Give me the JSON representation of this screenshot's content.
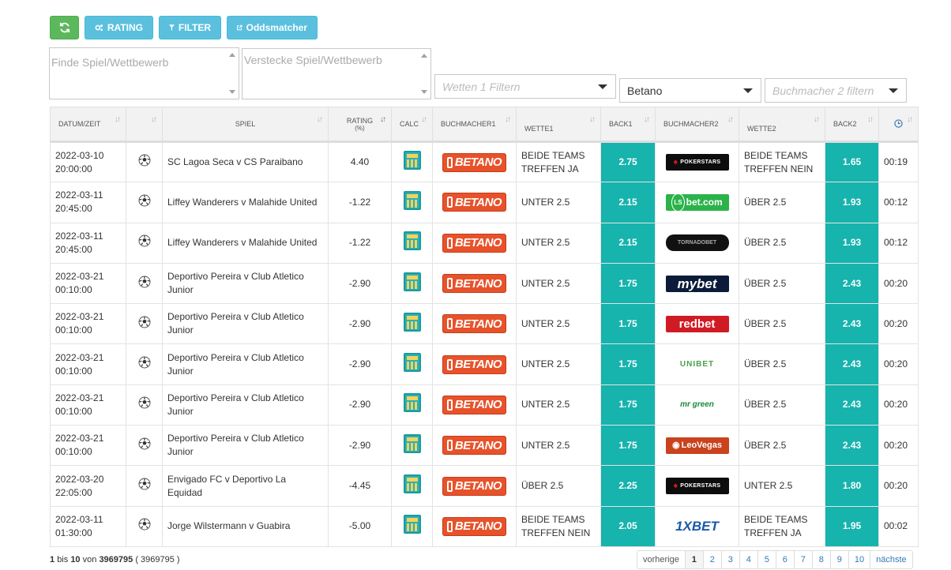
{
  "toolbar": {
    "refresh_icon": "refresh-icon",
    "rating_label": "RATING",
    "filter_label": "FILTER",
    "oddsmatcher_label": "Oddsmatcher",
    "colors": {
      "green": "#5cb85c",
      "blue": "#5bc0de"
    }
  },
  "filters": {
    "find_placeholder": "Finde Spiel/Wettbewerb",
    "hide_placeholder": "Verstecke Spiel/Wettbewerb",
    "bet1_placeholder": "Wetten 1 Filtern",
    "bookmaker1_value": "Betano",
    "bookmaker2_placeholder": "Buchmacher 2 filtern"
  },
  "table": {
    "headers": {
      "date": "DATUM/ZEIT",
      "game": "SPIEL",
      "rating": "RATING",
      "rating_sub": "(%)",
      "calc": "CALC",
      "bookmaker1": "BUCHMACHER1",
      "bet1": "WETTE1",
      "back1": "BACK1",
      "bookmaker2": "BUCHMACHER2",
      "bet2": "WETTE2",
      "back2": "BACK2"
    },
    "accent_color": "#17b3ad",
    "rows": [
      {
        "date": "2022-03-10",
        "time": "20:00:00",
        "game": "SC Lagoa Seca v CS Paraibano",
        "rating": "4.40",
        "bookmaker1": "BETANO",
        "bet1": "BEIDE TEAMS TREFFEN JA",
        "back1": "2.75",
        "bookmaker2": "POKERSTARS",
        "bet2": "BEIDE TEAMS TREFFEN NEIN",
        "back2": "1.65",
        "age": "00:19"
      },
      {
        "date": "2022-03-11",
        "time": "20:45:00",
        "game": "Liffey Wanderers v Malahide United",
        "rating": "-1.22",
        "bookmaker1": "BETANO",
        "bet1": "UNTER 2.5",
        "back1": "2.15",
        "bookmaker2": "bet.com",
        "bet2": "ÜBER 2.5",
        "back2": "1.93",
        "age": "00:12"
      },
      {
        "date": "2022-03-11",
        "time": "20:45:00",
        "game": "Liffey Wanderers v Malahide United",
        "rating": "-1.22",
        "bookmaker1": "BETANO",
        "bet1": "UNTER 2.5",
        "back1": "2.15",
        "bookmaker2": "TORNADOBET",
        "bet2": "ÜBER 2.5",
        "back2": "1.93",
        "age": "00:12"
      },
      {
        "date": "2022-03-21",
        "time": "00:10:00",
        "game": "Deportivo Pereira v Club Atletico Junior",
        "rating": "-2.90",
        "bookmaker1": "BETANO",
        "bet1": "UNTER 2.5",
        "back1": "1.75",
        "bookmaker2": "mybet",
        "bet2": "ÜBER 2.5",
        "back2": "2.43",
        "age": "00:20"
      },
      {
        "date": "2022-03-21",
        "time": "00:10:00",
        "game": "Deportivo Pereira v Club Atletico Junior",
        "rating": "-2.90",
        "bookmaker1": "BETANO",
        "bet1": "UNTER 2.5",
        "back1": "1.75",
        "bookmaker2": "redbet",
        "bet2": "ÜBER 2.5",
        "back2": "2.43",
        "age": "00:20"
      },
      {
        "date": "2022-03-21",
        "time": "00:10:00",
        "game": "Deportivo Pereira v Club Atletico Junior",
        "rating": "-2.90",
        "bookmaker1": "BETANO",
        "bet1": "UNTER 2.5",
        "back1": "1.75",
        "bookmaker2": "UNIBET",
        "bet2": "ÜBER 2.5",
        "back2": "2.43",
        "age": "00:20"
      },
      {
        "date": "2022-03-21",
        "time": "00:10:00",
        "game": "Deportivo Pereira v Club Atletico Junior",
        "rating": "-2.90",
        "bookmaker1": "BETANO",
        "bet1": "UNTER 2.5",
        "back1": "1.75",
        "bookmaker2": "mr green",
        "bet2": "ÜBER 2.5",
        "back2": "2.43",
        "age": "00:20"
      },
      {
        "date": "2022-03-21",
        "time": "00:10:00",
        "game": "Deportivo Pereira v Club Atletico Junior",
        "rating": "-2.90",
        "bookmaker1": "BETANO",
        "bet1": "UNTER 2.5",
        "back1": "1.75",
        "bookmaker2": "LeoVegas",
        "bet2": "ÜBER 2.5",
        "back2": "2.43",
        "age": "00:20"
      },
      {
        "date": "2022-03-20",
        "time": "22:05:00",
        "game": "Envigado FC v Deportivo La Equidad",
        "rating": "-4.45",
        "bookmaker1": "BETANO",
        "bet1": "ÜBER 2.5",
        "back1": "2.25",
        "bookmaker2": "POKERSTARS",
        "bet2": "UNTER 2.5",
        "back2": "1.80",
        "age": "00:20"
      },
      {
        "date": "2022-03-11",
        "time": "01:30:00",
        "game": "Jorge Wilstermann v Guabira",
        "rating": "-5.00",
        "bookmaker1": "BETANO",
        "bet1": "BEIDE TEAMS TREFFEN NEIN",
        "back1": "2.05",
        "bookmaker2": "1XBET",
        "bet2": "BEIDE TEAMS TREFFEN JA",
        "back2": "1.95",
        "age": "00:02"
      }
    ]
  },
  "footer": {
    "from": "1",
    "bis": "bis",
    "to": "10",
    "von": "von",
    "total": "3969795",
    "total_paren": "( 3969795 )"
  },
  "pagination": [
    "vorherige",
    "1",
    "2",
    "3",
    "4",
    "5",
    "6",
    "7",
    "8",
    "9",
    "10",
    "nächste"
  ],
  "pagination_active": "1"
}
